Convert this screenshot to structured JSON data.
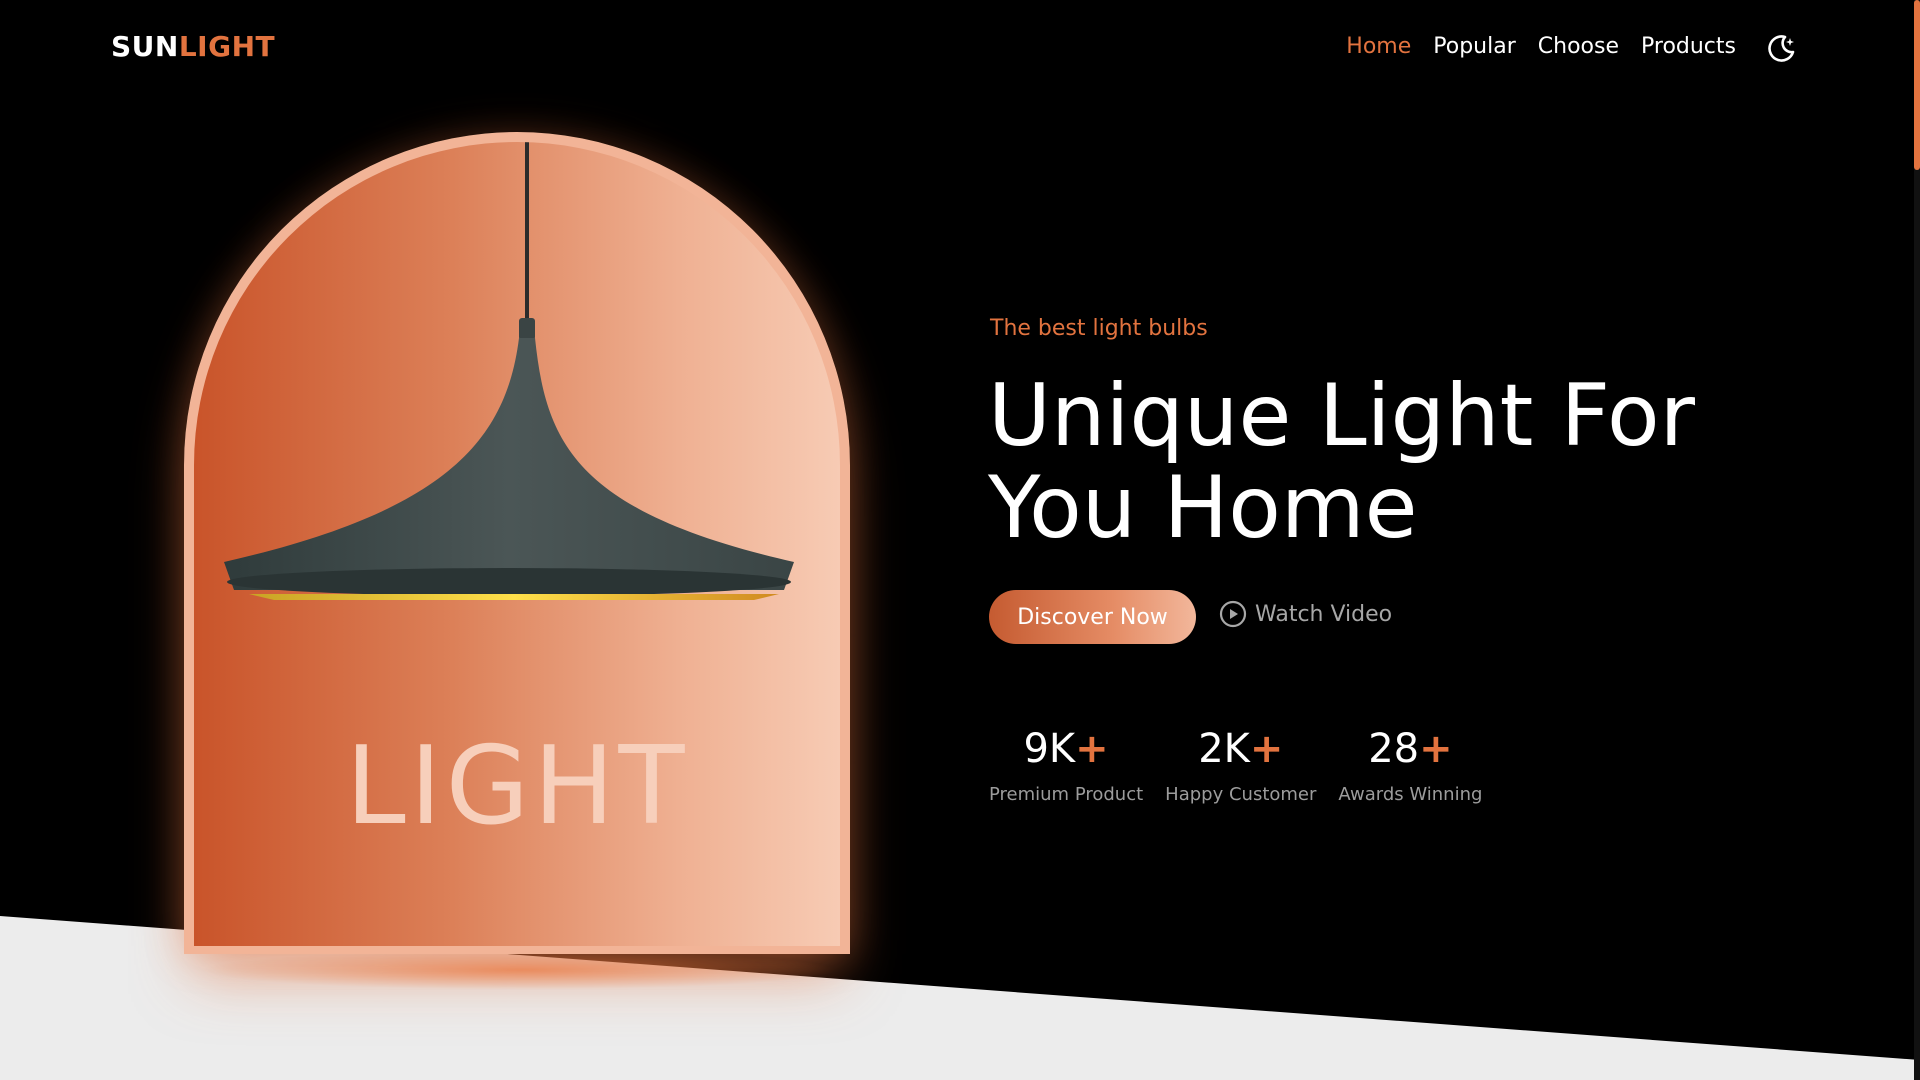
{
  "header": {
    "logo_part1": "SUN",
    "logo_part2": "LIGHT",
    "nav": [
      {
        "label": "Home",
        "active": true
      },
      {
        "label": "Popular",
        "active": false
      },
      {
        "label": "Choose",
        "active": false
      },
      {
        "label": "Products",
        "active": false
      }
    ],
    "theme_icon": "moon-stars-icon"
  },
  "hero": {
    "image_word": "LIGHT",
    "subtitle": "The best light bulbs",
    "title_line1": "Unique Light For",
    "title_line2": "You Home",
    "primary_button": "Discover Now",
    "secondary_button": "Watch Video",
    "secondary_icon": "play-circle-icon"
  },
  "stats": [
    {
      "number": "9K",
      "plus": "+",
      "label": "Premium Product"
    },
    {
      "number": "2K",
      "plus": "+",
      "label": "Happy Customer"
    },
    {
      "number": "28",
      "plus": "+",
      "label": "Awards Winning"
    }
  ],
  "colors": {
    "accent": "#e2733f",
    "background": "#000000",
    "band": "#ececec",
    "text": "#ffffff",
    "muted": "#9c9c9c"
  }
}
